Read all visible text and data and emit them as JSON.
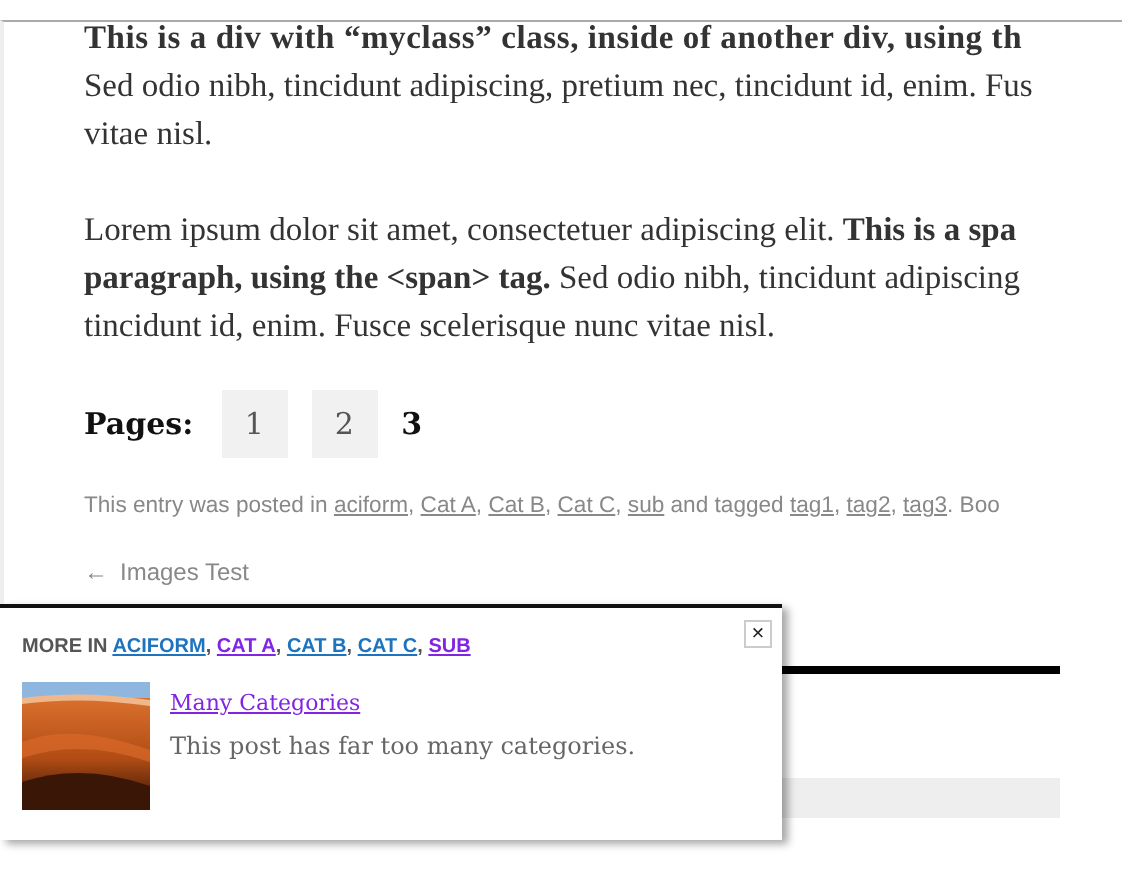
{
  "paragraphs": [
    {
      "lines": [
        {
          "text": "This is a div with “myclass” class, inside of another div, using th",
          "bold": true
        },
        {
          "text": "Sed odio nibh, tincidunt adipiscing, pretium nec, tincidunt id, enim. Fus",
          "bold": false
        },
        {
          "text": "vitae nisl.",
          "bold": false
        }
      ]
    },
    {
      "lines": [
        {
          "text": "Lorem ipsum dolor sit amet, consectetuer adipiscing elit. **This is a spa**",
          "bold": false
        },
        {
          "text": "**paragraph, using the <span> tag.** Sed odio nibh, tincidunt adipiscing",
          "bold": false
        },
        {
          "text": "tincidunt id, enim. Fusce scelerisque nunc vitae nisl.",
          "bold": false
        }
      ]
    }
  ],
  "pages": {
    "label": "Pages:",
    "items": [
      {
        "text": "1",
        "selected": false
      },
      {
        "text": "2",
        "selected": false
      },
      {
        "text": "3",
        "selected": true
      }
    ]
  },
  "entry_meta": [
    {
      "kind": "text",
      "text": "This entry was posted in "
    },
    {
      "kind": "link",
      "text": "aciform"
    },
    {
      "kind": "text",
      "text": ", "
    },
    {
      "kind": "link",
      "text": "Cat A"
    },
    {
      "kind": "text",
      "text": ", "
    },
    {
      "kind": "link",
      "text": "Cat B"
    },
    {
      "kind": "text",
      "text": ", "
    },
    {
      "kind": "link",
      "text": "Cat C"
    },
    {
      "kind": "text",
      "text": ", "
    },
    {
      "kind": "link",
      "text": "sub"
    },
    {
      "kind": "text",
      "text": " and tagged "
    },
    {
      "kind": "link",
      "text": "tag1"
    },
    {
      "kind": "text",
      "text": ", "
    },
    {
      "kind": "link",
      "text": "tag2"
    },
    {
      "kind": "text",
      "text": ", "
    },
    {
      "kind": "link",
      "text": "tag3"
    },
    {
      "kind": "text",
      "text": ". Boo"
    }
  ],
  "previous_post": {
    "arrow": "←",
    "title": "Images Test"
  },
  "popup": {
    "close": "×",
    "heading": "MORE IN",
    "categories": [
      {
        "kind": "link",
        "text": "ACIFORM",
        "visited": false
      },
      {
        "kind": "text",
        "text": ", "
      },
      {
        "kind": "link",
        "text": "CAT A",
        "visited": true
      },
      {
        "kind": "text",
        "text": ", "
      },
      {
        "kind": "link",
        "text": "CAT B",
        "visited": false
      },
      {
        "kind": "text",
        "text": ", "
      },
      {
        "kind": "link",
        "text": "CAT C",
        "visited": false
      },
      {
        "kind": "text",
        "text": ", "
      },
      {
        "kind": "link",
        "text": "SUB",
        "visited": true
      }
    ],
    "post": {
      "title": "Many Categories",
      "title_visited": true,
      "excerpt": "This post has far too many categories."
    }
  }
}
